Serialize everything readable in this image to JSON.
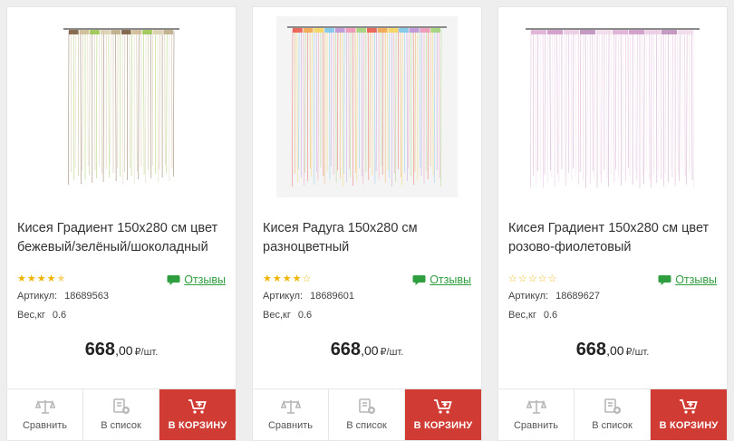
{
  "colors": {
    "accent": "#d03c34",
    "reviews": "#2e9e3e",
    "star": "#f0b400"
  },
  "labels": {
    "sku": "Артикул:",
    "weight": "Вес,кг",
    "reviews": "Отзывы",
    "compare": "Сравнить",
    "wishlist": "В список",
    "cart": "В КОРЗИНУ",
    "currency": "₽/шт."
  },
  "products": [
    {
      "title": "Кисея Градиент 150х280 см цвет бежевый/зелёный/шоколадный",
      "rating": 4.5,
      "sku": "18689563",
      "weight": "0.6",
      "price_whole": "668",
      "price_cents": ",00",
      "image_icon": "curtain-image",
      "image_colors": [
        "#6b4a2b",
        "#c9b48a",
        "#8fbf3a",
        "#d8c9a8",
        "#b8a27a"
      ]
    },
    {
      "title": "Кисея Радуга 150х280 см разноцветный",
      "rating": 4,
      "sku": "18689601",
      "weight": "0.6",
      "price_whole": "668",
      "price_cents": ",00",
      "image_icon": "curtain-image",
      "image_colors": [
        "#e8473a",
        "#f3a03a",
        "#f6d34a",
        "#6cc3e8",
        "#b58ad8",
        "#f08ab0",
        "#9ad06a"
      ]
    },
    {
      "title": "Кисея Градиент 150х280 см цвет розово-фиолетовый",
      "rating": 0,
      "sku": "18689627",
      "weight": "0.6",
      "price_whole": "668",
      "price_cents": ",00",
      "image_icon": "curtain-image",
      "image_colors": [
        "#d9a6cf",
        "#c98fc0",
        "#e8c6e0",
        "#b783b5",
        "#f0d8ea"
      ]
    }
  ]
}
